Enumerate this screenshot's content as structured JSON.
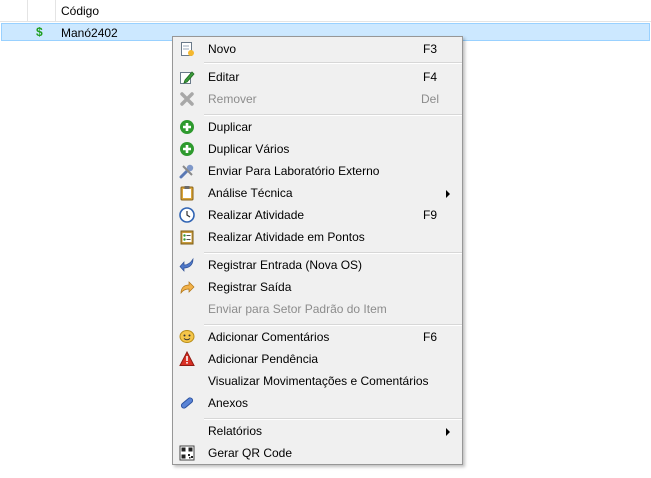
{
  "grid": {
    "column_header": "Código",
    "row": {
      "icon": "$",
      "code": "Manó2402"
    }
  },
  "menu": {
    "items": [
      {
        "label": "Novo",
        "shortcut": "F3",
        "icon": "new-document-icon"
      },
      {
        "label": "Editar",
        "shortcut": "F4",
        "icon": "edit-pencil-icon"
      },
      {
        "label": "Remover",
        "shortcut": "Del",
        "icon": "remove-x-icon",
        "disabled": true
      },
      {
        "label": "Duplicar",
        "shortcut": "",
        "icon": "green-plus-icon"
      },
      {
        "label": "Duplicar Vários",
        "shortcut": "",
        "icon": "green-plus-icon"
      },
      {
        "label": "Enviar Para Laboratório Externo",
        "shortcut": "",
        "icon": "tools-icon"
      },
      {
        "label": "Análise Técnica",
        "shortcut": "",
        "icon": "clipboard-icon",
        "submenu": true
      },
      {
        "label": "Realizar Atividade",
        "shortcut": "F9",
        "icon": "clock-icon"
      },
      {
        "label": "Realizar Atividade em Pontos",
        "shortcut": "",
        "icon": "points-list-icon"
      },
      {
        "label": "Registrar Entrada (Nova OS)",
        "shortcut": "",
        "icon": "return-arrow-icon"
      },
      {
        "label": "Registrar Saída",
        "shortcut": "",
        "icon": "forward-arrow-icon"
      },
      {
        "label": "Enviar para Setor Padrão do Item",
        "shortcut": "",
        "icon": "",
        "disabled": true
      },
      {
        "label": "Adicionar Comentários",
        "shortcut": "F6",
        "icon": "comment-face-icon"
      },
      {
        "label": "Adicionar Pendência",
        "shortcut": "",
        "icon": "warning-icon"
      },
      {
        "label": "Visualizar Movimentações e Comentários",
        "shortcut": "",
        "icon": ""
      },
      {
        "label": "Anexos",
        "shortcut": "",
        "icon": "paperclip-icon"
      },
      {
        "label": "Relatórios",
        "shortcut": "",
        "icon": "",
        "submenu": true
      },
      {
        "label": "Gerar QR Code",
        "shortcut": "",
        "icon": "qr-code-icon"
      }
    ]
  }
}
